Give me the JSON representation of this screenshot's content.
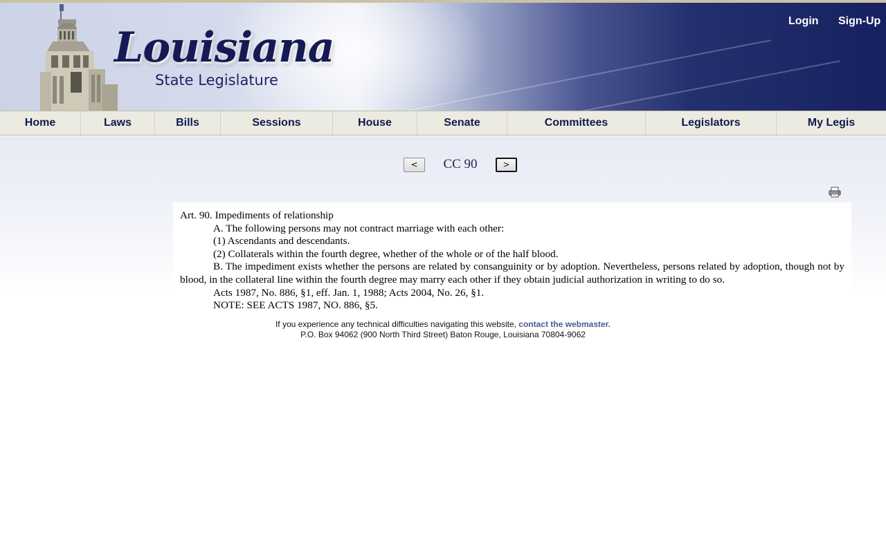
{
  "header": {
    "logo_script": "Louisiana",
    "logo_subtitle": "State Legislature",
    "login_label": "Login",
    "signup_label": "Sign-Up"
  },
  "nav": {
    "items": [
      {
        "label": "Home"
      },
      {
        "label": "Laws"
      },
      {
        "label": "Bills"
      },
      {
        "label": "Sessions"
      },
      {
        "label": "House"
      },
      {
        "label": "Senate"
      },
      {
        "label": "Committees"
      },
      {
        "label": "Legislators"
      },
      {
        "label": "My Legis"
      }
    ]
  },
  "pager": {
    "prev_label": "<",
    "title": "CC 90",
    "next_label": ">"
  },
  "icons": {
    "print": "printer-icon"
  },
  "article": {
    "heading": "Art. 90.  Impediments of relationship",
    "para_a": "A.  The following persons may not contract marriage with each other:",
    "item_1": "(1)  Ascendants and descendants.",
    "item_2": "(2)  Collaterals within the fourth degree, whether of the whole or of the half blood.",
    "para_b": "B.  The impediment exists whether the persons are related by consanguinity or by adoption.  Nevertheless, persons related by adoption, though not by blood, in the collateral line within the fourth degree may marry each other if they obtain judicial authorization in writing to do so.",
    "acts": "Acts 1987, No. 886, §1, eff. Jan. 1, 1988; Acts 2004, No. 26, §1.",
    "note": "NOTE:  SEE ACTS 1987, NO. 886, §5."
  },
  "footer": {
    "help_text": "If you experience any technical difficulties navigating this website,",
    "contact_link": "contact the webmaster.",
    "address": "P.O. Box 94062 (900 North Third Street) Baton Rouge, Louisiana 70804-9062"
  }
}
